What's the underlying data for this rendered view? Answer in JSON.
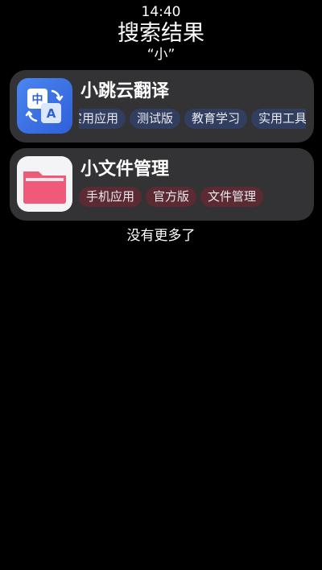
{
  "status_bar": {
    "time": "14:40"
  },
  "header": {
    "title": "搜索结果",
    "query": "“小”"
  },
  "results": [
    {
      "name": "小跳云翻译",
      "icon": "translate-icon",
      "tags": [
        "实用应用",
        "测试版",
        "教育学习",
        "实用工具"
      ]
    },
    {
      "name": "小文件管理",
      "icon": "folder-icon",
      "tags": [
        "手机应用",
        "官方版",
        "文件管理"
      ]
    }
  ],
  "footer": {
    "no_more_text": "没有更多了"
  },
  "colors": {
    "background": "#000000",
    "card": "#333335",
    "tag_blue": "#313e60",
    "tag_red": "#5b2a33",
    "translate_icon_bg": "#3b6fe6",
    "folder_color": "#ee5a78"
  }
}
